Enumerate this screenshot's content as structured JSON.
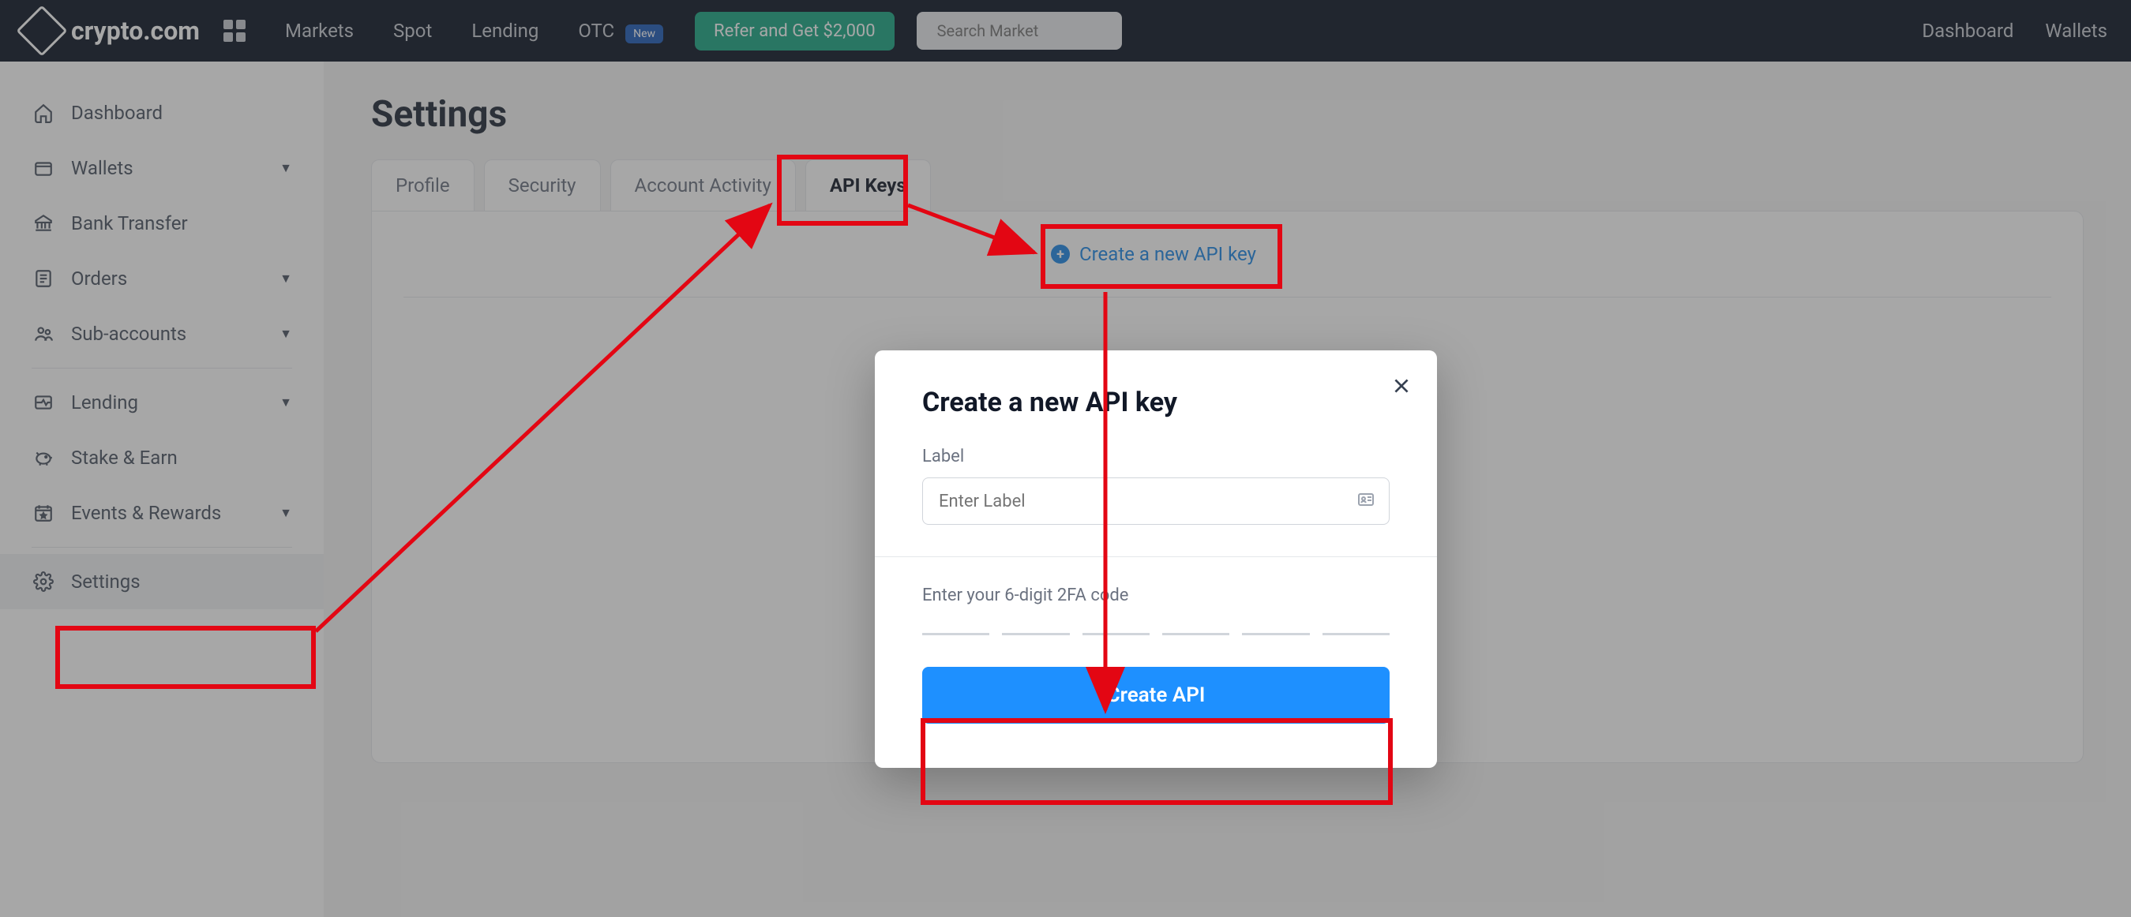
{
  "topnav": {
    "brand": "crypto.com",
    "links": {
      "markets": "Markets",
      "spot": "Spot",
      "lending": "Lending",
      "otc": "OTC",
      "otc_badge": "New"
    },
    "refer_label": "Refer and Get $2,000",
    "search_placeholder": "Search Market",
    "right": {
      "dashboard": "Dashboard",
      "wallets": "Wallets"
    }
  },
  "sidebar": {
    "items": [
      {
        "label": "Dashboard",
        "expandable": false
      },
      {
        "label": "Wallets",
        "expandable": true
      },
      {
        "label": "Bank Transfer",
        "expandable": false
      },
      {
        "label": "Orders",
        "expandable": true
      },
      {
        "label": "Sub-accounts",
        "expandable": true
      },
      {
        "label": "Lending",
        "expandable": true
      },
      {
        "label": "Stake & Earn",
        "expandable": false
      },
      {
        "label": "Events & Rewards",
        "expandable": true
      },
      {
        "label": "Settings",
        "expandable": false,
        "active": true
      }
    ]
  },
  "page": {
    "title": "Settings",
    "tabs": {
      "profile": "Profile",
      "security": "Security",
      "activity": "Account Activity",
      "apikeys": "API Keys"
    },
    "create_link": "Create a new API key"
  },
  "modal": {
    "title": "Create a new API key",
    "label_field": "Label",
    "label_placeholder": "Enter Label",
    "tfa_label": "Enter your 6-digit 2FA code",
    "submit": "Create API"
  },
  "annotation_color": "#e30613"
}
